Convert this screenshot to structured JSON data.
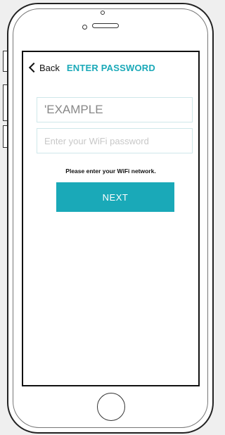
{
  "nav": {
    "back_label": "Back",
    "title": "ENTER PASSWORD"
  },
  "form": {
    "ssid_value": "'EXAMPLE",
    "password_placeholder": "Enter your WiFi password",
    "hint": "Please enter your WiFi network.",
    "next_label": "NEXT"
  },
  "colors": {
    "accent": "#1aa9b8"
  }
}
